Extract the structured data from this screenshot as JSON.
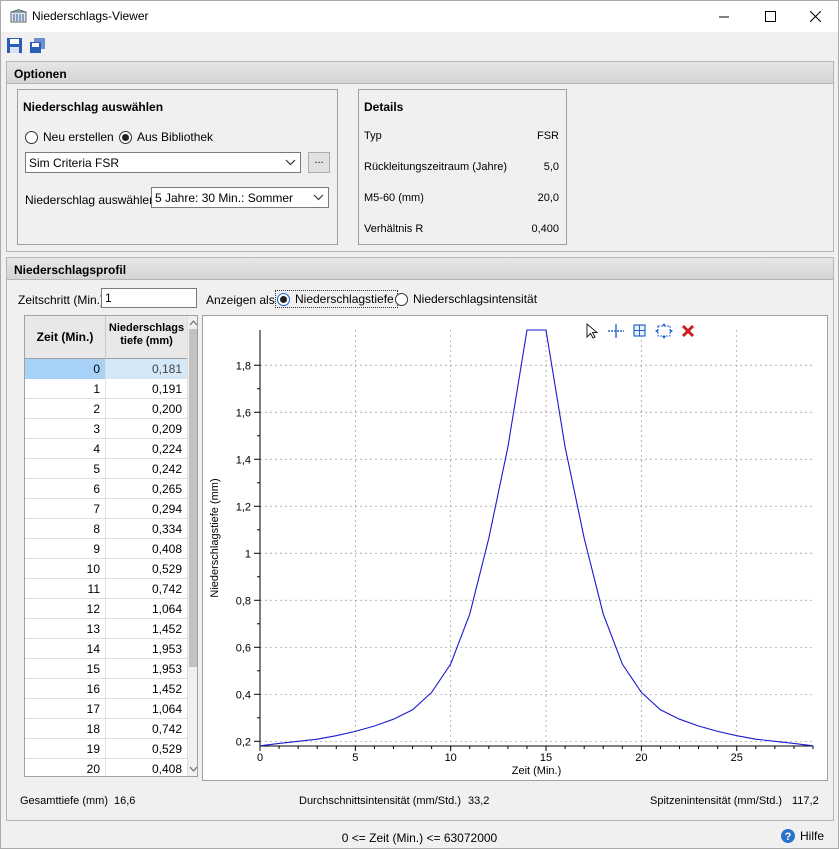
{
  "window": {
    "title": "Niederschlags-Viewer",
    "controls": [
      "minimize",
      "maximize",
      "close"
    ]
  },
  "toolbar": {
    "icons": [
      "save-icon",
      "save-all-icon"
    ]
  },
  "options": {
    "header": "Optionen",
    "select_group": {
      "title": "Niederschlag auswählen",
      "radio_new": "Neu erstellen",
      "radio_library": "Aus Bibliothek",
      "selected_radio": "library",
      "library_value": "Sim Criteria FSR",
      "browse_label": "...",
      "select_label": "Niederschlag auswählen",
      "select_value": "5 Jahre: 30 Min.: Sommer"
    },
    "details": {
      "title": "Details",
      "rows": [
        {
          "label": "Typ",
          "value": "FSR"
        },
        {
          "label": "Rückleitungszeitraum (Jahre)",
          "value": "5,0"
        },
        {
          "label": "M5-60 (mm)",
          "value": "20,0"
        },
        {
          "label": "Verhältnis R",
          "value": "0,400"
        }
      ]
    }
  },
  "profile": {
    "header": "Niederschlagsprofil",
    "timestep_label": "Zeitschritt (Min.)",
    "timestep_value": "1",
    "show_as_label": "Anzeigen als",
    "radio_depth": "Niederschlagstiefe",
    "radio_intensity": "Niederschlagsintensität",
    "selected_radio": "depth",
    "table": {
      "col1": "Zeit (Min.)",
      "col2_line1": "Niederschlags",
      "col2_line2": "tiefe (mm)",
      "rows": [
        [
          "0",
          "0,181"
        ],
        [
          "1",
          "0,191"
        ],
        [
          "2",
          "0,200"
        ],
        [
          "3",
          "0,209"
        ],
        [
          "4",
          "0,224"
        ],
        [
          "5",
          "0,242"
        ],
        [
          "6",
          "0,265"
        ],
        [
          "7",
          "0,294"
        ],
        [
          "8",
          "0,334"
        ],
        [
          "9",
          "0,408"
        ],
        [
          "10",
          "0,529"
        ],
        [
          "11",
          "0,742"
        ],
        [
          "12",
          "1,064"
        ],
        [
          "13",
          "1,452"
        ],
        [
          "14",
          "1,953"
        ],
        [
          "15",
          "1,953"
        ],
        [
          "16",
          "1,452"
        ],
        [
          "17",
          "1,064"
        ],
        [
          "18",
          "0,742"
        ],
        [
          "19",
          "0,529"
        ],
        [
          "20",
          "0,408"
        ]
      ],
      "selected_row": 0
    },
    "chart_tools": [
      "pointer-icon",
      "crosshair-icon",
      "zoom-box-icon",
      "pan-icon",
      "reset-icon"
    ],
    "summary": {
      "total_label": "Gesamttiefe (mm)",
      "total_value": "16,6",
      "avg_label": "Durchschnittsintensität (mm/Std.)",
      "avg_value": "33,2",
      "peak_label": "Spitzenintensität (mm/Std.)",
      "peak_value": "117,2"
    }
  },
  "status": {
    "range_text": "0 <= Zeit (Min.) <= 63072000",
    "help_label": "Hilfe"
  },
  "colors": {
    "series": "#1a1ad0",
    "selection": "#a6d2f7",
    "close_tool": "#cc1f1f"
  },
  "chart_data": {
    "type": "line",
    "xlabel": "Zeit (Min.)",
    "ylabel": "Niederschlagstiefe (mm)",
    "xlim": [
      0,
      29
    ],
    "ylim": [
      0.18,
      1.95
    ],
    "x_ticks": [
      0,
      5,
      10,
      15,
      20,
      25
    ],
    "y_ticks": [
      0.2,
      0.4,
      0.6,
      0.8,
      1,
      1.2,
      1.4,
      1.6,
      1.8
    ],
    "y_tick_labels": [
      "0,2",
      "0,4",
      "0,6",
      "0,8",
      "1",
      "1,2",
      "1,4",
      "1,6",
      "1,8"
    ],
    "grid": true,
    "series": [
      {
        "x": [
          0,
          1,
          2,
          3,
          4,
          5,
          6,
          7,
          8,
          9,
          10,
          11,
          12,
          13,
          14,
          15,
          16,
          17,
          18,
          19,
          20,
          21,
          22,
          23,
          24,
          25,
          26,
          27,
          28,
          29
        ],
        "y": [
          0.181,
          0.191,
          0.2,
          0.209,
          0.224,
          0.242,
          0.265,
          0.294,
          0.334,
          0.408,
          0.529,
          0.742,
          1.064,
          1.452,
          1.953,
          1.953,
          1.452,
          1.064,
          0.742,
          0.529,
          0.408,
          0.334,
          0.294,
          0.265,
          0.242,
          0.224,
          0.209,
          0.2,
          0.191,
          0.181
        ]
      }
    ]
  }
}
